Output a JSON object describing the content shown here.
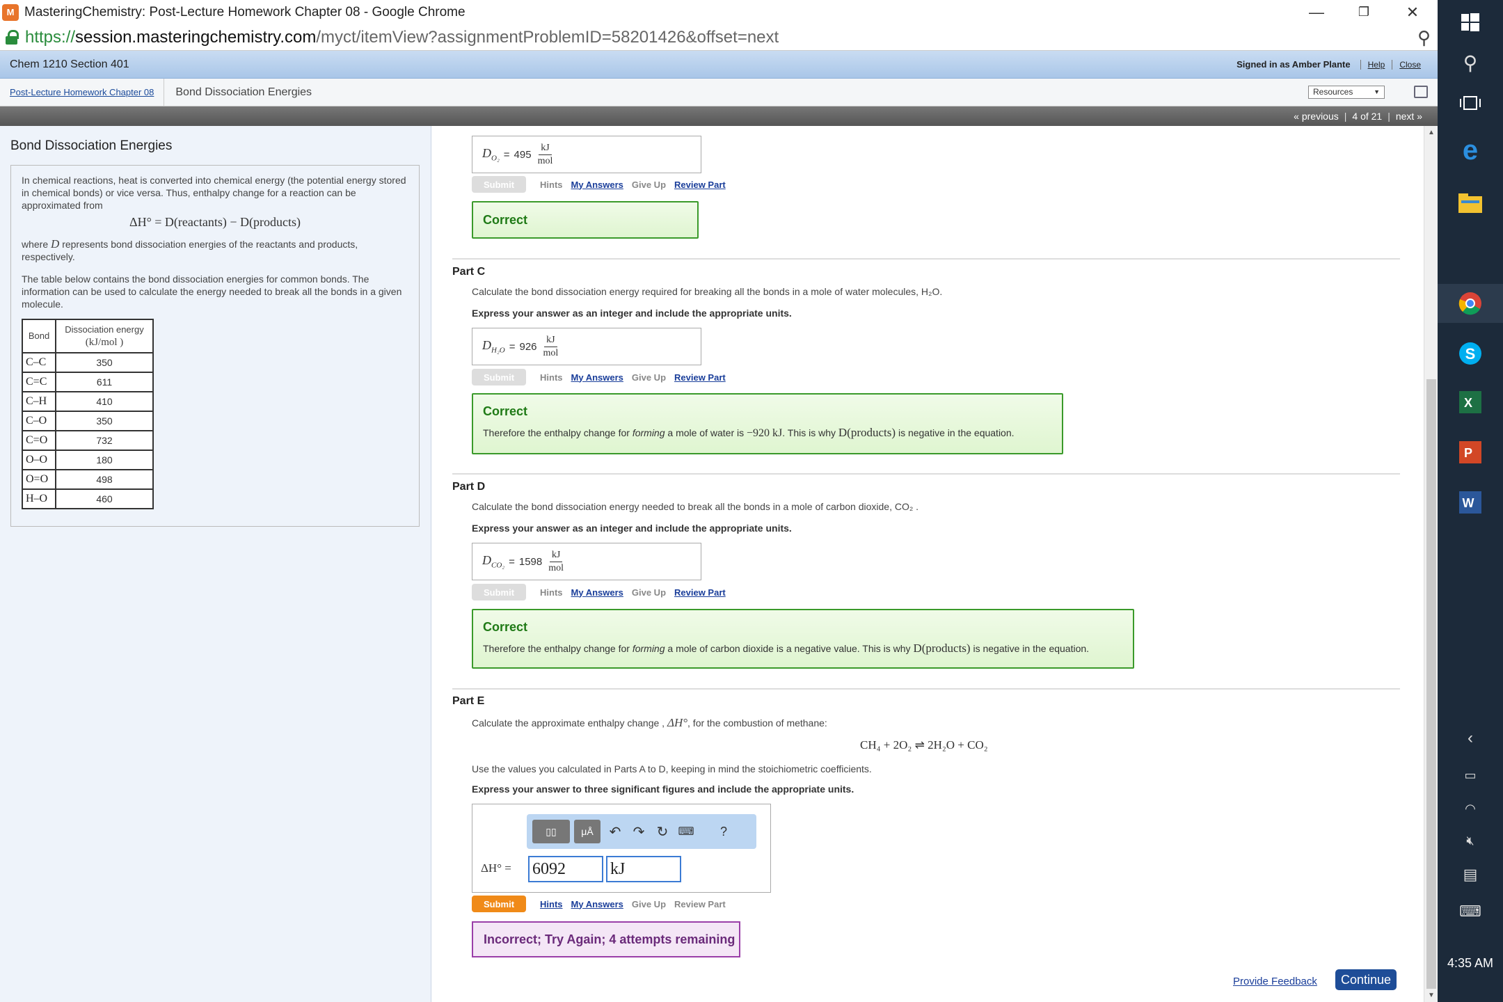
{
  "browser": {
    "window_title": "MasteringChemistry: Post-Lecture Homework Chapter 08 - Google Chrome",
    "url_scheme": "https://",
    "url_host": "session.masteringchemistry.com",
    "url_path": "/myct/itemView?assignmentProblemID=58201426&offset=next",
    "minimize_glyph": "—",
    "restore_glyph": "❐",
    "close_glyph": "✕"
  },
  "course": {
    "name": "Chem 1210 Section 401",
    "signed_in": "Signed in as Amber Plante",
    "help": "Help",
    "close": "Close"
  },
  "breadcrumb": {
    "assignment": "Post-Lecture Homework Chapter 08",
    "item": "Bond Dissociation Energies",
    "resources": "Resources"
  },
  "nav": {
    "previous": "« previous",
    "position": "4 of 21",
    "next": "next »"
  },
  "intro": {
    "title": "Bond Dissociation Energies",
    "p1": "In chemical reactions, heat is converted into chemical energy (the potential energy stored in chemical bonds) or vice versa. Thus, enthalpy change for a reaction can be approximated from",
    "equation": "ΔH° = D(reactants) − D(products)",
    "p2_a": "where ",
    "p2_var": "D",
    "p2_b": " represents bond dissociation energies of the reactants and products, respectively.",
    "p3": "The table below contains the bond dissociation energies for common bonds. The information can be used to calculate the energy needed to break all the bonds in a given molecule.",
    "table_header_bond": "Bond",
    "table_header_energy": "Dissociation energy",
    "table_header_unit": "(kJ/mol )",
    "rows": [
      {
        "bond": "C–C",
        "energy": "350"
      },
      {
        "bond": "C=C",
        "energy": "611"
      },
      {
        "bond": "C–H",
        "energy": "410"
      },
      {
        "bond": "C–O",
        "energy": "350"
      },
      {
        "bond": "C=O",
        "energy": "732"
      },
      {
        "bond": "O–O",
        "energy": "180"
      },
      {
        "bond": "O=O",
        "energy": "498"
      },
      {
        "bond": "H–O",
        "energy": "460"
      }
    ]
  },
  "actions": {
    "submit": "Submit",
    "hints": "Hints",
    "my_answers": "My Answers",
    "give_up": "Give Up",
    "review_part": "Review Part"
  },
  "unit": {
    "num": "kJ",
    "den": "mol"
  },
  "partB": {
    "label": "D",
    "sub": "O₂",
    "eq": "=",
    "value": "495",
    "correct": "Correct"
  },
  "partC": {
    "title": "Part C",
    "question": "Calculate the bond dissociation energy required for breaking all the bonds in a mole of water molecules, H₂O.",
    "instruction": "Express your answer as an integer and include the appropriate units.",
    "label": "D",
    "sub": "H₂O",
    "eq": "=",
    "value": "926",
    "correct": "Correct",
    "explain_a": "Therefore the enthalpy change for ",
    "explain_em": "forming",
    "explain_b": " a mole of water is ",
    "explain_val": "−920 kJ",
    "explain_c": ". This is why ",
    "explain_d": "D(products)",
    "explain_e": " is negative in the equation."
  },
  "partD": {
    "title": "Part D",
    "question": "Calculate the bond dissociation energy needed to break all the bonds in a mole of carbon dioxide, CO₂ .",
    "instruction": "Express your answer as an integer and include the appropriate units.",
    "label": "D",
    "sub": "CO₂",
    "eq": "=",
    "value": "1598",
    "correct": "Correct",
    "explain_a": "Therefore the enthalpy change for ",
    "explain_em": "forming",
    "explain_b": " a mole of carbon dioxide is a negative value. This is why ",
    "explain_d": "D(products)",
    "explain_e": " is negative in the equation."
  },
  "partE": {
    "title": "Part E",
    "question_a": "Calculate the approximate enthalpy change , ",
    "question_var": "ΔH°",
    "question_b": ", for the combustion of methane:",
    "reaction": "CH₄ + 2O₂ ⇌ 2H₂O + CO₂",
    "note": "Use the values you calculated in Parts A to D, keeping in mind the stoichiometric coefficients.",
    "instruction": "Express your answer to three significant figures and include the appropriate units.",
    "answer_label": "ΔH° =",
    "value": "6092",
    "unit": "kJ",
    "templates_btn": "▯▯",
    "mu_btn": "μÅ",
    "help_btn": "?",
    "incorrect": "Incorrect; Try Again; 4 attempts remaining"
  },
  "footer": {
    "feedback": "Provide Feedback",
    "continue": "Continue"
  },
  "taskbar": {
    "time": "4:35 AM"
  }
}
